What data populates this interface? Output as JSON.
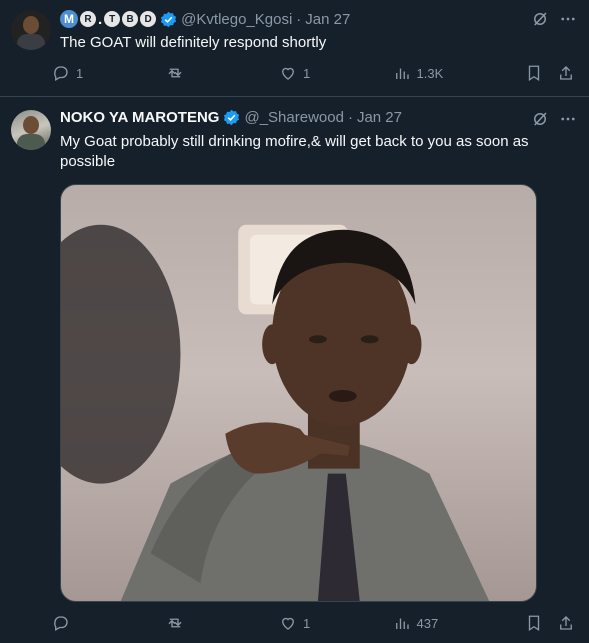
{
  "tweets": [
    {
      "display_name_text": "M.",
      "display_name_badges": [
        "M",
        "R",
        "T",
        "B",
        "D"
      ],
      "handle": "@Kvtlego_Kgosi",
      "separator": "·",
      "time": "Jan 27",
      "text": "The GOAT will definitely respond shortly",
      "replies": "1",
      "retweets": "",
      "likes": "1",
      "views": "1.3K"
    },
    {
      "display_name": "NOKO YA MAROTENG",
      "handle": "@_Sharewood",
      "separator": "·",
      "time": "Jan 27",
      "text": "My Goat probably still drinking mofire,& will get back to you as soon as possible",
      "replies": "",
      "retweets": "",
      "likes": "1",
      "views": "437",
      "media_description": "man in grey shirt and tie pointing at camera"
    }
  ],
  "colors": {
    "background": "#15202b",
    "text_primary": "#f7f9f9",
    "text_secondary": "#8b98a5",
    "verified": "#1d9bf0",
    "divider": "#38444d"
  },
  "icons": [
    "verified-badge-icon",
    "grok-icon",
    "more-icon",
    "reply-icon",
    "retweet-icon",
    "like-icon",
    "views-icon",
    "bookmark-icon",
    "share-icon"
  ]
}
